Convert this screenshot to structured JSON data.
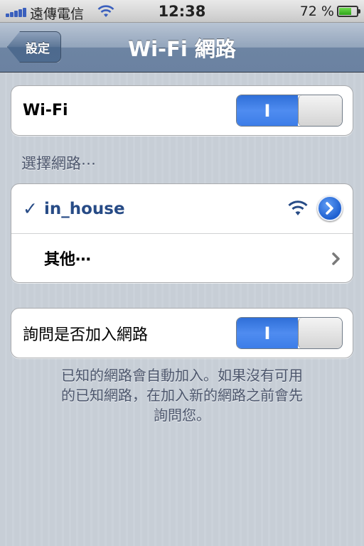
{
  "status_bar": {
    "carrier": "遠傳電信",
    "time": "12:38",
    "battery_percent": "72 %",
    "battery_level": 0.72,
    "signal_icon": "signal-bars-icon",
    "wifi_icon": "wifi-icon"
  },
  "nav": {
    "back_label": "設定",
    "title": "Wi-Fi 網路"
  },
  "wifi_toggle": {
    "label": "Wi-Fi",
    "state_label": "I",
    "on": true
  },
  "networks": {
    "header": "選擇網路⋯",
    "items": [
      {
        "name": "in_house",
        "connected": true,
        "check": "✓"
      }
    ],
    "other_label": "其他⋯"
  },
  "ask_toggle": {
    "label": "詢問是否加入網路",
    "state_label": "I",
    "on": true
  },
  "footer": {
    "line1": "已知的網路會自動加入。如果沒有可用",
    "line2": "的已知網路，在加入新的網路之前會先",
    "line3": "詢問您。"
  },
  "colors": {
    "accent_blue": "#3c7de8",
    "network_text": "#274b86",
    "background": "#c5ccd4"
  }
}
